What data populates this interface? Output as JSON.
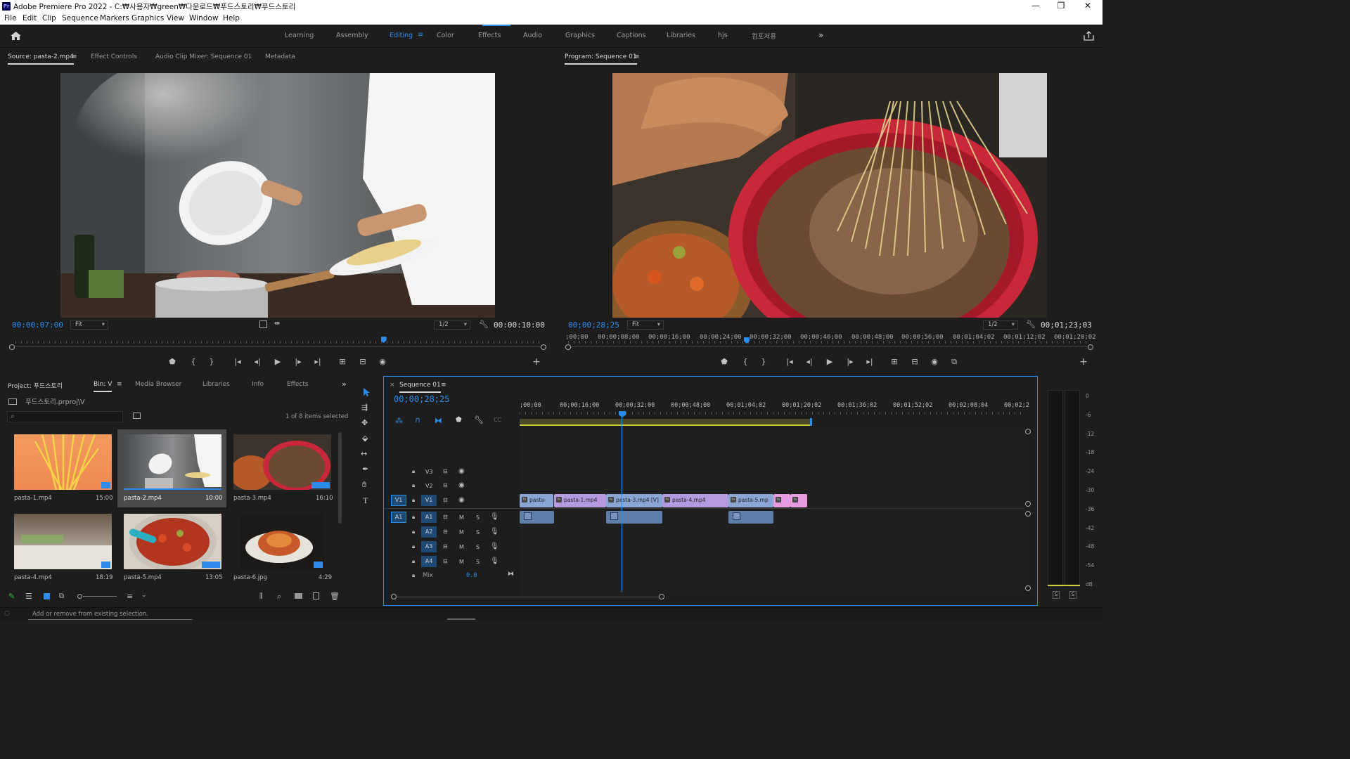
{
  "titlebar": {
    "app_icon": "Pr",
    "title": "Adobe Premiere Pro 2022 - C:₩사용자₩green₩다운로드₩푸드스토리₩푸드스토리",
    "minimize_icon": "—",
    "maximize_icon": "❐",
    "close_icon": "✕"
  },
  "menu": [
    "File",
    "Edit",
    "Clip",
    "Sequence",
    "Markers",
    "Graphics",
    "View",
    "Window",
    "Help"
  ],
  "workspaces": {
    "items": [
      "Learning",
      "Assembly",
      "Editing",
      "Color",
      "Effects",
      "Audio",
      "Graphics",
      "Captions",
      "Libraries",
      "hjs",
      "컴포저용"
    ],
    "active": "Editing",
    "overflow_icon": "»",
    "home_icon": "home-icon",
    "share_icon": "share-icon"
  },
  "source_monitor": {
    "tabs": [
      "Source: pasta-2.mp4",
      "Effect Controls",
      "Audio Clip Mixer: Sequence 01",
      "Metadata"
    ],
    "timecode": "00:00:07:00",
    "fit": "Fit",
    "resolution": "1/2",
    "duration": "00:00:10:00",
    "playhead_fraction": 0.7
  },
  "program_monitor": {
    "tab": "Program: Sequence 01",
    "timecode": "00;00;28;25",
    "fit": "Fit",
    "resolution": "1/2",
    "duration": "00;01;23;03",
    "ruler_labels": [
      ";00;00",
      "00;00;08;00",
      "00;00;16;00",
      "00;00;24;00",
      "00;00;32;00",
      "00;00;40;00",
      "00;00;48;00",
      "00;00;56;00",
      "00;01;04;02",
      "00;01;12;02",
      "00;01;20;02"
    ]
  },
  "transport_icons": {
    "marker": "⬟",
    "in": "{",
    "out": "}",
    "go_in": "|◂",
    "step_back": "◂|",
    "play": "▶",
    "step_fwd": "|▸",
    "go_out": "▸|",
    "insert": "⊞",
    "overwrite": "⊟",
    "export_frame": "◉",
    "add": "+"
  },
  "project": {
    "tabs": [
      "Project: 푸드스토리",
      "Bin: V",
      "Media Browser",
      "Libraries",
      "Info",
      "Effects"
    ],
    "project_file": "푸드스토리.prproj\\V",
    "search_placeholder": "",
    "selection_status": "1 of 8 items selected",
    "items": [
      {
        "name": "pasta-1.mp4",
        "duration": "15:00"
      },
      {
        "name": "pasta-2.mp4",
        "duration": "10:00"
      },
      {
        "name": "pasta-3.mp4",
        "duration": "16:10"
      },
      {
        "name": "pasta-4.mp4",
        "duration": "18:19"
      },
      {
        "name": "pasta-5.mp4",
        "duration": "13:05"
      },
      {
        "name": "pasta-6.jpg",
        "duration": "4:29"
      }
    ],
    "selected_item": "pasta-2.mp4"
  },
  "timeline": {
    "tab": "Sequence 01",
    "timecode": "00;00;28;25",
    "ruler_labels": [
      ";00;00",
      "00;00;16;00",
      "00;00;32;00",
      "00;00;48;00",
      "00;01;04;02",
      "00;01;20;02",
      "00;01;36;02",
      "00;01;52;02",
      "00;02;08;04",
      "00;02;2"
    ],
    "video_tracks": [
      "V3",
      "V2",
      "V1"
    ],
    "audio_tracks": [
      "A1",
      "A2",
      "A3",
      "A4"
    ],
    "source_patch_video": "V1",
    "source_patch_audio": "A1",
    "mute_label": "M",
    "solo_label": "S",
    "mix_label": "Mix",
    "mix_value": "0.0",
    "v1_clips": [
      {
        "label": "pasta-",
        "color": "#8aa6d4"
      },
      {
        "label": "pasta-1.mp4",
        "color": "#b59ae0"
      },
      {
        "label": "pasta-3.mp4 [V]",
        "color": "#8aa6d4"
      },
      {
        "label": "pasta-4.mp4",
        "color": "#b59ae0"
      },
      {
        "label": "pasta-5.mp",
        "color": "#8aa6d4"
      },
      {
        "label": "",
        "color": "#e69ae0"
      },
      {
        "label": "",
        "color": "#e69ae0"
      }
    ]
  },
  "meter": {
    "scale": [
      "0",
      "-6",
      "-12",
      "-18",
      "-24",
      "-30",
      "-36",
      "-42",
      "-48",
      "-54",
      "dB"
    ],
    "solo_buttons": [
      "S",
      "S"
    ]
  },
  "statusbar": {
    "text": "Add or remove from existing selection."
  },
  "colors": {
    "accent": "#2d8ceb",
    "panel_bg": "#1d1d1d",
    "work_area": "#c9c93a"
  }
}
